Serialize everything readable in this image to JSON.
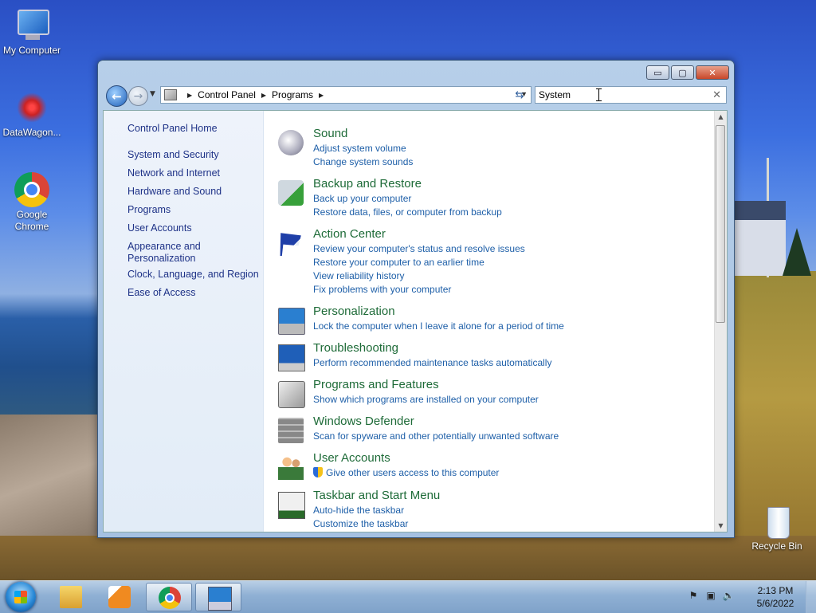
{
  "desktop": {
    "icons": [
      {
        "label": "My Computer"
      },
      {
        "label": "DataWagon..."
      },
      {
        "label": "Google\nChrome"
      },
      {
        "label": "Recycle Bin"
      }
    ]
  },
  "window": {
    "title_buttons": {
      "minimize": "▭",
      "maximize": "▢",
      "close": "✕"
    },
    "breadcrumb": [
      "Control Panel",
      "Programs"
    ],
    "search": {
      "value": "System",
      "clear": "✕"
    }
  },
  "sidebar": {
    "home": "Control Panel Home",
    "items": [
      "System and Security",
      "Network and Internet",
      "Hardware and Sound",
      "Programs",
      "User Accounts",
      "Appearance and\nPersonalization",
      "Clock, Language, and Region",
      "Ease of Access"
    ]
  },
  "results": [
    {
      "title": "Sound",
      "icon": "speaker-icon",
      "links": [
        "Adjust system volume",
        "Change system sounds"
      ]
    },
    {
      "title": "Backup and Restore",
      "icon": "backup-icon",
      "links": [
        "Back up your computer",
        "Restore data, files, or computer from backup"
      ]
    },
    {
      "title": "Action Center",
      "icon": "flag-icon",
      "links": [
        "Review your computer's status and resolve issues",
        "Restore your computer to an earlier time",
        "View reliability history",
        "Fix problems with your computer"
      ]
    },
    {
      "title": "Personalization",
      "icon": "personalization-icon",
      "links": [
        "Lock the computer when I leave it alone for a period of time"
      ]
    },
    {
      "title": "Troubleshooting",
      "icon": "troubleshooting-icon",
      "links": [
        "Perform recommended maintenance tasks automatically"
      ]
    },
    {
      "title": "Programs and Features",
      "icon": "programs-icon",
      "links": [
        "Show which programs are installed on your computer"
      ]
    },
    {
      "title": "Windows Defender",
      "icon": "defender-icon",
      "links": [
        "Scan for spyware and other potentially unwanted software"
      ]
    },
    {
      "title": "User Accounts",
      "icon": "users-icon",
      "links": [
        "Give other users access to this computer"
      ]
    },
    {
      "title": "Taskbar and Start Menu",
      "icon": "taskbar-icon",
      "links": [
        "Auto-hide the taskbar",
        "Customize the taskbar"
      ]
    }
  ],
  "taskbar": {
    "clock": {
      "time": "2:13 PM",
      "date": "5/6/2022"
    }
  }
}
